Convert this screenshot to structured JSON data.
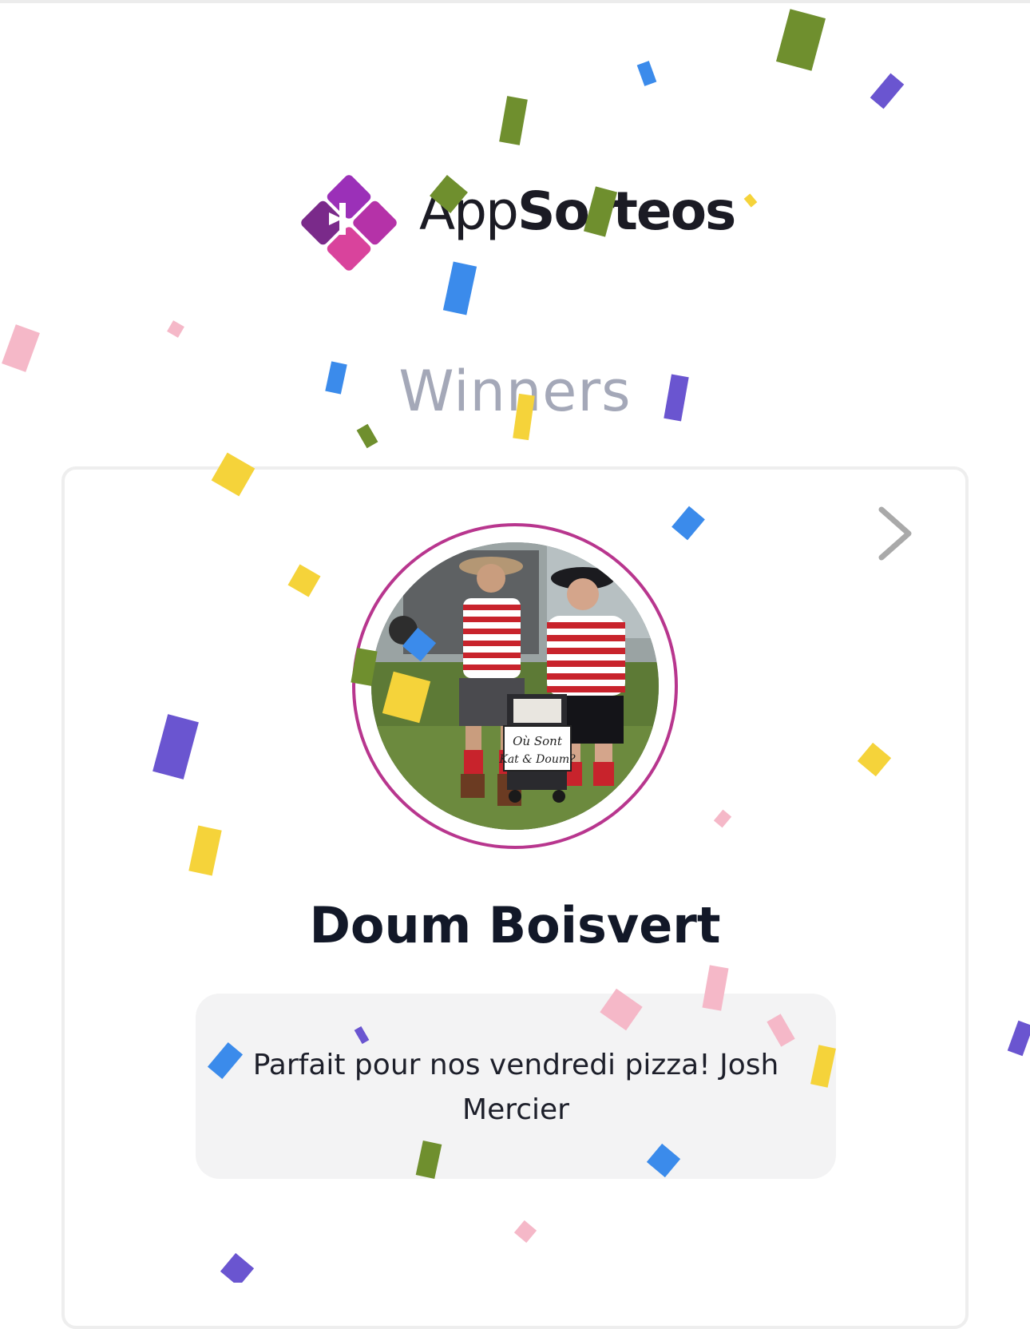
{
  "brand": {
    "name_light": "App",
    "name_bold": "Sorteos",
    "logo_icon": "gift-diamond-logo-icon",
    "colors": {
      "purple": "#8e2fb4",
      "pink": "#d6449e",
      "magenta": "#b8368e"
    }
  },
  "header": {
    "title": "Winners"
  },
  "winner": {
    "name": "Doum Boisvert",
    "message": "Parfait pour nos vendredi pizza! Josh Mercier",
    "avatar_sign_line1": "Où Sont",
    "avatar_sign_line2": "Kat & Doum?"
  },
  "navigation": {
    "next_icon": "chevron-right-icon"
  },
  "confetti_colors": [
    "#6f8f2e",
    "#3b8beb",
    "#6a55d0",
    "#f5d33a",
    "#f5b8c8"
  ]
}
